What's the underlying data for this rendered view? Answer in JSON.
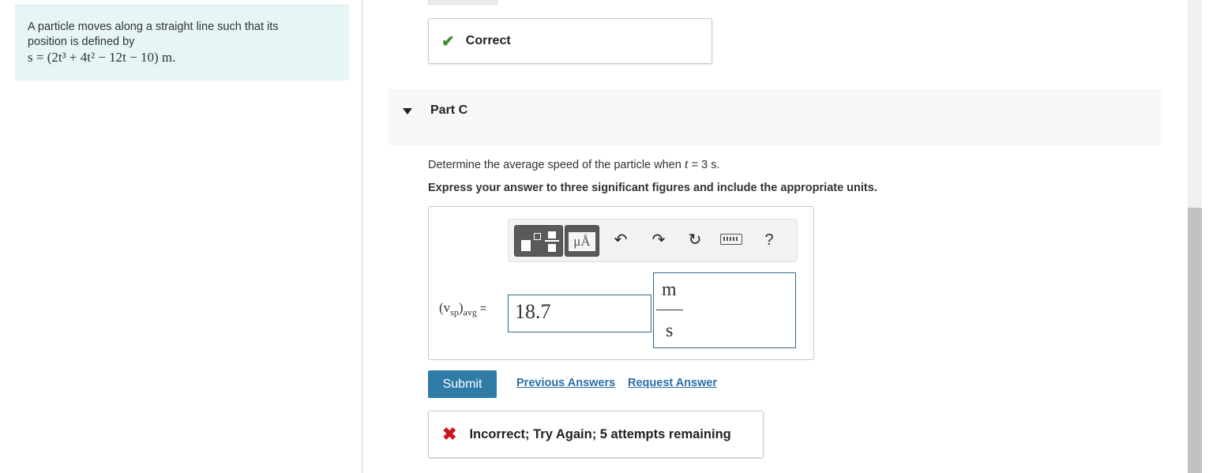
{
  "problem": {
    "text_line1": "A particle moves along a straight line such that its",
    "text_line2": "position is defined by",
    "equation": "s = (2t³ + 4t² − 12t − 10) m."
  },
  "part_b_feedback": {
    "status": "Correct"
  },
  "part_c": {
    "label": "Part C",
    "question_prefix": "Determine the average speed of the particle when",
    "question_var": "t",
    "question_suffix": "= 3 s.",
    "instruction": "Express your answer to three significant figures and include the appropriate units."
  },
  "toolbar": {
    "units_button_label": "μÅ",
    "help_label": "?",
    "undo_glyph": "↶",
    "redo_glyph": "↷",
    "reset_glyph": "↻"
  },
  "answer": {
    "var_main": "(v",
    "var_sub": "sp",
    "var_close": ")",
    "var_sub2": "avg",
    "equals": "=",
    "value": "18.7",
    "unit_numerator": "m",
    "unit_denominator": "s"
  },
  "actions": {
    "submit_label": "Submit",
    "previous_answers_label": "Previous Answers",
    "request_answer_label": "Request Answer"
  },
  "feedback": {
    "message": "Incorrect; Try Again; 5 attempts remaining"
  },
  "colors": {
    "accent": "#2e7ba8",
    "correct": "#3f8e35",
    "incorrect": "#d0141c",
    "problem_bg": "#e6f5f5"
  }
}
